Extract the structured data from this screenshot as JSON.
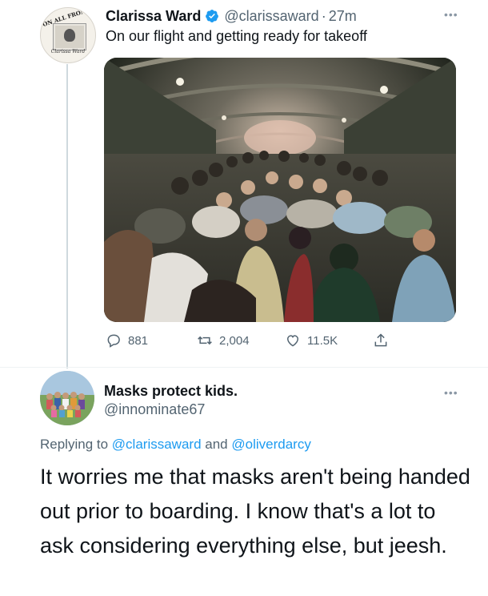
{
  "tweet": {
    "author_name": "Clarissa Ward",
    "author_handle": "@clarissaward",
    "separator": "·",
    "time": "27m",
    "text": "On our flight and getting ready for takeoff",
    "avatar_banner": "ON ALL FRONTS",
    "avatar_signature": "Clarissa Ward",
    "stats": {
      "replies": "881",
      "retweets": "2,004",
      "likes": "11.5K"
    }
  },
  "reply": {
    "author_name": "Masks protect kids.",
    "author_handle": "@innominate67",
    "replying_prefix": "Replying to",
    "replying_to_1": "@clarissaward",
    "replying_and": "and",
    "replying_to_2": "@oliverdarcy",
    "text": "It worries me that masks aren't being handed out prior to boarding. I know that's a lot to ask considering everything else, but jeesh."
  },
  "icons": {
    "verified": "verified-badge-icon",
    "more": "more-options-icon",
    "reply": "reply-icon",
    "retweet": "retweet-icon",
    "like": "heart-icon",
    "share": "share-icon"
  },
  "colors": {
    "text": "#0f1419",
    "secondary": "#536471",
    "accent": "#1d9bf0"
  }
}
